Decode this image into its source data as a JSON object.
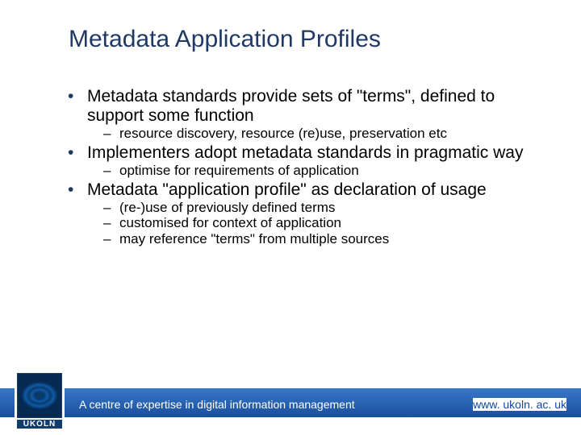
{
  "title": "Metadata Application Profiles",
  "bullets": [
    {
      "text": "Metadata standards provide sets of \"terms\", defined to support some function",
      "sub": [
        "resource discovery, resource (re)use, preservation etc"
      ]
    },
    {
      "text": "Implementers adopt metadata standards in pragmatic way",
      "sub": [
        "optimise for requirements of application"
      ]
    },
    {
      "text": "Metadata \"application profile\" as declaration of usage",
      "sub": [
        "(re-)use of previously defined terms",
        "customised for context of application",
        "may reference \"terms\" from multiple sources"
      ]
    }
  ],
  "footer": {
    "tagline": "A centre of expertise in digital information management",
    "url": "www. ukoln. ac. uk",
    "logo_text": "UKOLN"
  }
}
